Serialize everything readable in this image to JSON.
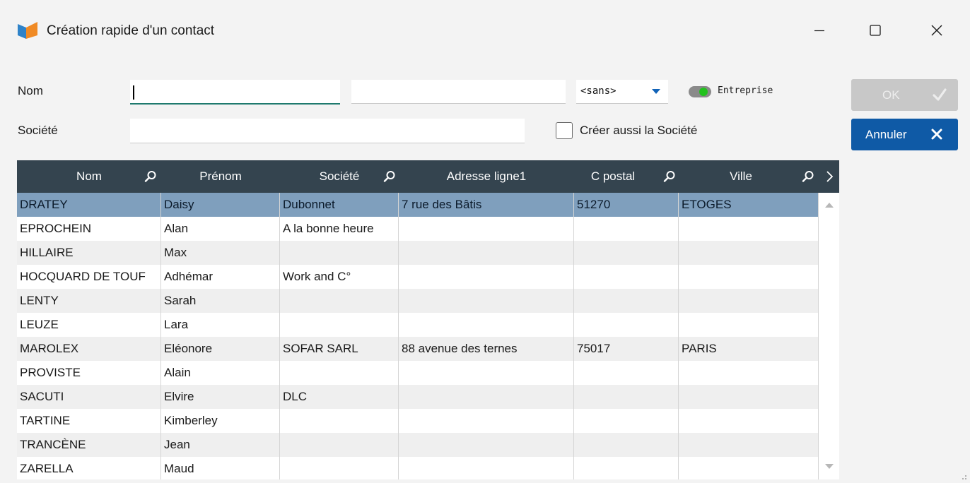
{
  "window": {
    "title": "Création rapide d'un contact",
    "controls": [
      "minimize-icon",
      "maximize-icon",
      "close-icon"
    ]
  },
  "form": {
    "nom_label": "Nom",
    "nom_value": "",
    "prenom_value": "",
    "civilite_value": "<sans>",
    "entreprise_label": "Entreprise",
    "entreprise_on": true,
    "societe_label": "Société",
    "societe_value": "",
    "creer_societe_label": "Créer aussi la Société",
    "creer_societe_checked": false
  },
  "buttons": {
    "ok_label": "OK",
    "cancel_label": "Annuler"
  },
  "colors": {
    "header_bg": "#34444f",
    "selected_row": "#7f9fbd",
    "cancel_button": "#0f5aa6",
    "toggle_on": "#22c21d",
    "select_arrow": "#1163b8"
  },
  "table": {
    "columns": [
      "Nom",
      "Prénom",
      "Société",
      "Adresse ligne1",
      "C postal",
      "Ville"
    ],
    "rows": [
      [
        "DRATEY",
        "Daisy",
        "Dubonnet",
        "7 rue des Bâtis",
        "51270",
        "ETOGES"
      ],
      [
        "EPROCHEIN",
        "Alan",
        "A la bonne heure",
        "",
        "",
        ""
      ],
      [
        "HILLAIRE",
        "Max",
        "",
        "",
        "",
        ""
      ],
      [
        "HOCQUARD DE TOUF",
        "Adhémar",
        "Work and C°",
        "",
        "",
        ""
      ],
      [
        "LENTY",
        "Sarah",
        "",
        "",
        "",
        ""
      ],
      [
        "LEUZE",
        "Lara",
        "",
        "",
        "",
        ""
      ],
      [
        "MAROLEX",
        "Eléonore",
        "SOFAR SARL",
        "88 avenue des ternes",
        "75017",
        "PARIS"
      ],
      [
        "PROVISTE",
        "Alain",
        "",
        "",
        "",
        ""
      ],
      [
        "SACUTI",
        "Elvire",
        "DLC",
        "",
        "",
        ""
      ],
      [
        "TARTINE",
        "Kimberley",
        "",
        "",
        "",
        ""
      ],
      [
        "TRANCÈNE",
        "Jean",
        "",
        "",
        "",
        ""
      ],
      [
        "ZARELLA",
        "Maud",
        "",
        "",
        "",
        ""
      ]
    ],
    "selected_row": 0
  }
}
